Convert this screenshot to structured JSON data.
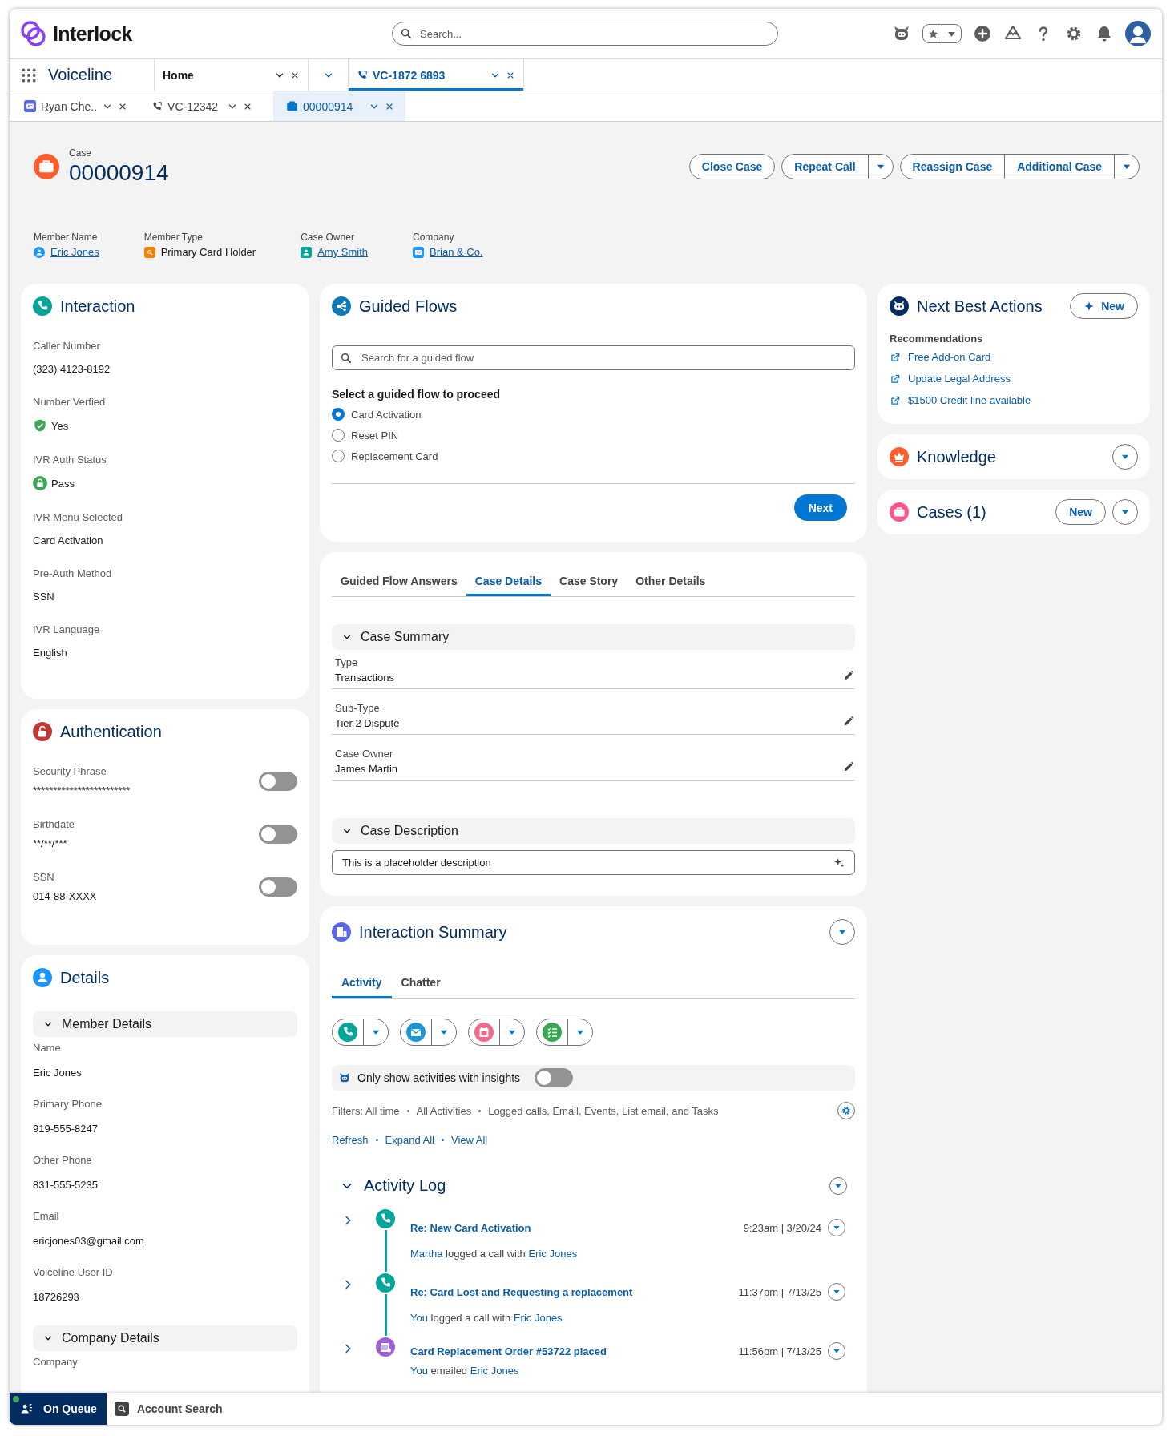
{
  "header": {
    "brand": "Interlock",
    "search_placeholder": "Search..."
  },
  "nav": {
    "app_name": "Voiceline",
    "tabs": [
      {
        "label": "Home",
        "kind": "home",
        "selected": false
      },
      {
        "label": "VC-1872 6893",
        "kind": "call",
        "selected": true
      }
    ]
  },
  "subtabs": [
    {
      "label": "Ryan Che..",
      "kind": "contact",
      "selected": false
    },
    {
      "label": "VC-12342",
      "kind": "call",
      "selected": false
    },
    {
      "label": "00000914",
      "kind": "case",
      "selected": true
    }
  ],
  "record": {
    "object_label": "Case",
    "title": "00000914",
    "action_groups": [
      {
        "buttons": [
          "Close Case"
        ],
        "menu": false
      },
      {
        "buttons": [
          "Repeat Call"
        ],
        "menu": true
      },
      {
        "buttons": [
          "Reassign Case",
          "Additional Case"
        ],
        "menu": true
      }
    ],
    "highlights": [
      {
        "label": "Member Name",
        "value": "Eric Jones",
        "kind": "person",
        "link": true
      },
      {
        "label": "Member Type",
        "value": "Primary Card Holder",
        "kind": "member",
        "link": false
      },
      {
        "label": "Case Owner",
        "value": "Amy Smith",
        "kind": "owner",
        "link": true
      },
      {
        "label": "Company",
        "value": "Brian & Co.",
        "kind": "company",
        "link": true
      }
    ]
  },
  "interaction": {
    "title": "Interaction",
    "fields": [
      {
        "label": "Caller Number",
        "value": "(323) 4123-8192",
        "kind": "text"
      },
      {
        "label": "Number Verfied",
        "value": "Yes",
        "kind": "verified"
      },
      {
        "label": "IVR Auth Status",
        "value": "Pass",
        "kind": "unlocked"
      },
      {
        "label": "IVR Menu Selected",
        "value": "Card Activation",
        "kind": "text"
      },
      {
        "label": "Pre-Auth Method",
        "value": "SSN",
        "kind": "text"
      },
      {
        "label": "IVR Language",
        "value": "English",
        "kind": "text"
      }
    ]
  },
  "authentication": {
    "title": "Authentication",
    "fields": [
      {
        "label": "Security Phrase",
        "value": "************************",
        "on": false
      },
      {
        "label": "Birthdate",
        "value": "**/**/***",
        "on": false
      },
      {
        "label": "SSN",
        "value": "014-88-XXXX",
        "on": false
      }
    ]
  },
  "details": {
    "title": "Details",
    "sections": [
      {
        "title": "Member Details",
        "expanded": true,
        "fields": [
          {
            "label": "Name",
            "value": "Eric Jones"
          },
          {
            "label": "Primary Phone",
            "value": "919-555-8247"
          },
          {
            "label": "Other Phone",
            "value": "831-555-5235"
          },
          {
            "label": "Email",
            "value": "ericjones03@gmail.com"
          },
          {
            "label": "Voiceline User ID",
            "value": "18726293"
          }
        ]
      },
      {
        "title": "Company Details",
        "expanded": true,
        "fields": [
          {
            "label": "Company"
          }
        ]
      }
    ]
  },
  "guided_flows": {
    "title": "Guided Flows",
    "search_placeholder": "Search for a guided flow",
    "prompt": "Select a guided flow to proceed",
    "options": [
      {
        "label": "Card Activation",
        "selected": true
      },
      {
        "label": "Reset PIN",
        "selected": false
      },
      {
        "label": "Replacement Card",
        "selected": false
      }
    ],
    "next_button": "Next"
  },
  "case_details": {
    "tabs": [
      {
        "label": "Guided Flow Answers",
        "selected": false
      },
      {
        "label": "Case Details",
        "selected": true
      },
      {
        "label": "Case Story",
        "selected": false
      },
      {
        "label": "Other Details",
        "selected": false
      }
    ],
    "sections": [
      {
        "title": "Case Summary",
        "expanded": true,
        "fields": [
          {
            "label": "Type",
            "value": "Transactions"
          },
          {
            "label": "Sub-Type",
            "value": "Tier 2 Dispute"
          },
          {
            "label": "Case Owner",
            "value": "James Martin"
          }
        ]
      }
    ],
    "description": {
      "title": "Case Description",
      "expanded": true,
      "value": "This is a placeholder description"
    }
  },
  "interaction_summary": {
    "title": "Interaction Summary",
    "tabs": [
      {
        "label": "Activity",
        "selected": true
      },
      {
        "label": "Chatter",
        "selected": false
      }
    ],
    "composers": [
      {
        "kind": "call"
      },
      {
        "kind": "email"
      },
      {
        "kind": "event"
      },
      {
        "kind": "task"
      }
    ],
    "insights_toggle": {
      "label": "Only show activities with insights",
      "on": false
    },
    "filters": [
      "Filters: All time",
      "All Activities",
      "Logged calls, Email, Events, List email, and Tasks"
    ],
    "links": [
      "Refresh",
      "Expand All",
      "View All"
    ],
    "activity_log": {
      "title": "Activity Log",
      "expanded": true,
      "items": [
        {
          "kind": "call",
          "title": "Re: New Card Activation",
          "time": "9:23am | 3/20/24",
          "actor": "Martha",
          "action": "logged a call with",
          "target": "Eric Jones"
        },
        {
          "kind": "call",
          "title": "Re: Card Lost and Requesting a replacement",
          "time": "11:37pm | 7/13/25",
          "actor": "You",
          "action": "logged a call with",
          "target": "Eric Jones"
        },
        {
          "kind": "order",
          "title": "Card Replacement Order #53722 placed",
          "time": "11:56pm | 7/13/25",
          "actor": "You",
          "action": "emailed",
          "target": "Eric Jones"
        }
      ]
    }
  },
  "next_best_actions": {
    "title": "Next Best Actions",
    "new_button": "New",
    "heading": "Recommendations",
    "items": [
      "Free Add-on Card",
      "Update Legal Address",
      "$1500 Credit line available"
    ]
  },
  "knowledge": {
    "title": "Knowledge"
  },
  "cases": {
    "title": "Cases (1)",
    "new_button": "New"
  },
  "utility_bar": [
    {
      "label": "On Queue",
      "kind": "queue",
      "selected": true
    },
    {
      "label": "Account Search",
      "kind": "search",
      "selected": false
    }
  ]
}
